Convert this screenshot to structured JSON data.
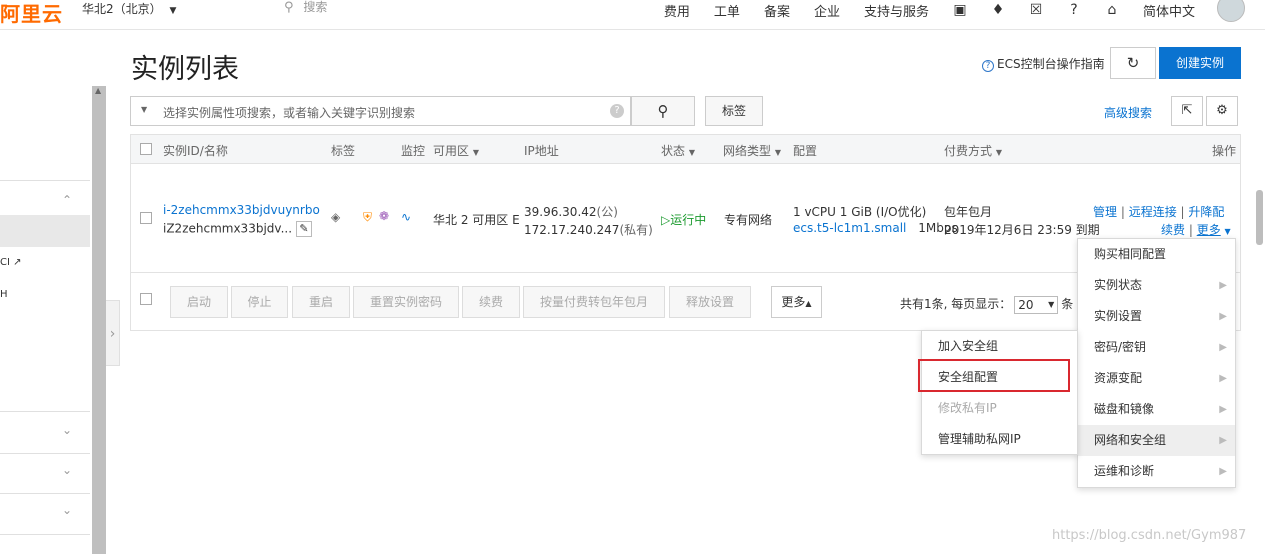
{
  "topbar": {
    "logo": "阿里云",
    "region": "华北2（北京）",
    "search_placeholder": "搜索",
    "nav": [
      "费用",
      "工单",
      "备案",
      "企业",
      "支持与服务"
    ],
    "language": "简体中文"
  },
  "sidebar": {
    "stubs": [
      "CI",
      "H"
    ]
  },
  "page": {
    "title": "实例列表",
    "guide": "ECS控制台操作指南",
    "create_label": "创建实例",
    "filter_placeholder": "选择实例属性项搜索，或者输入关键字识别搜索",
    "tag_label": "标签",
    "advanced_search": "高级搜索"
  },
  "table": {
    "headers": {
      "id": "实例ID/名称",
      "tag": "标签",
      "monitor": "监控",
      "zone": "可用区",
      "ip": "IP地址",
      "status": "状态",
      "network": "网络类型",
      "config": "配置",
      "billing": "付费方式",
      "action": "操作"
    },
    "row": {
      "id": "i-2zehcmmx33bjdvuynrbo",
      "name": "iZ2zehcmmx33bjdv...",
      "zone": "华北 2 可用区 E",
      "ip_public": "39.96.30.42",
      "ip_public_suffix": "(公)",
      "ip_private": "172.17.240.247",
      "ip_private_suffix": "(私有)",
      "status": "运行中",
      "network": "专有网络",
      "config_line1": "1 vCPU 1 GiB (I/O优化)",
      "config_type": "ecs.t5-lc1m1.small",
      "config_bw": "1Mbps",
      "billing_type": "包年包月",
      "expire": "2019年12月6日 23:59 到期",
      "actions": [
        "管理",
        "远程连接",
        "升降配"
      ],
      "renew": "续费",
      "more": "更多"
    }
  },
  "bulk": {
    "buttons": [
      "启动",
      "停止",
      "重启",
      "重置实例密码",
      "续费",
      "按量付费转包年包月",
      "释放设置"
    ],
    "more": "更多",
    "pager_prefix": "共有1条, 每页显示：",
    "page_size": "20",
    "pager_suffix": "条"
  },
  "more_menu": {
    "items": [
      "购买相同配置",
      "实例状态",
      "实例设置",
      "密码/密钥",
      "资源变配",
      "磁盘和镜像",
      "网络和安全组",
      "运维和诊断"
    ],
    "active": "网络和安全组"
  },
  "sub_menu": {
    "items": [
      "加入安全组",
      "安全组配置",
      "修改私有IP",
      "管理辅助私网IP"
    ],
    "disabled": "修改私有IP",
    "highlighted": "安全组配置"
  },
  "watermark": "https://blog.csdn.net/Gym987",
  "colors": {
    "accent": "#0a73d0",
    "brand": "#ff6a00",
    "running": "#1b9a2e",
    "highlight": "#d9282f"
  }
}
